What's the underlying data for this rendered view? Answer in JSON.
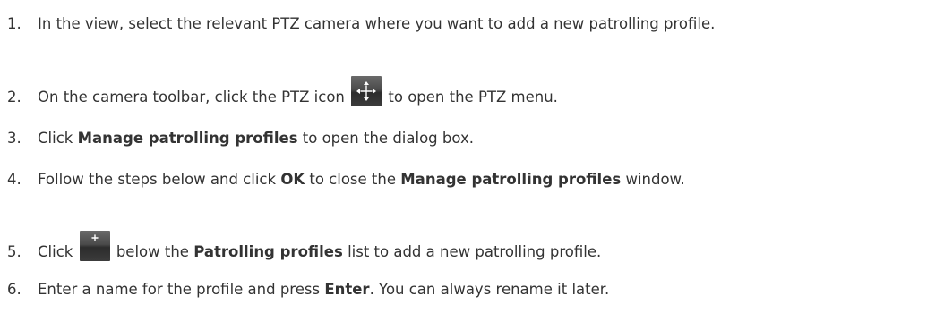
{
  "steps": [
    {
      "num": "1.",
      "text": "In the view, select the relevant PTZ camera where you want to add a new patrolling profile."
    },
    {
      "num": "2.",
      "before": "On the camera toolbar, click the PTZ icon",
      "icon": "ptz-move-icon",
      "after": "to open the PTZ menu."
    },
    {
      "num": "3.",
      "before": "Click",
      "bold": "Manage patrolling profiles",
      "after": "to open the dialog box."
    },
    {
      "num": "4.",
      "before": "Follow the steps below and click",
      "bold1": "OK",
      "mid": "to close the",
      "bold2": "Manage patrolling profiles",
      "after": "window."
    },
    {
      "num": "5.",
      "before": "Click",
      "icon": "add-icon",
      "mid": "below the",
      "bold": "Patrolling profiles",
      "after": "list to add a new patrolling profile."
    },
    {
      "num": "6.",
      "before": "Enter a name for the profile and press",
      "bold": "Enter",
      "after": ". You can always rename it later."
    }
  ]
}
